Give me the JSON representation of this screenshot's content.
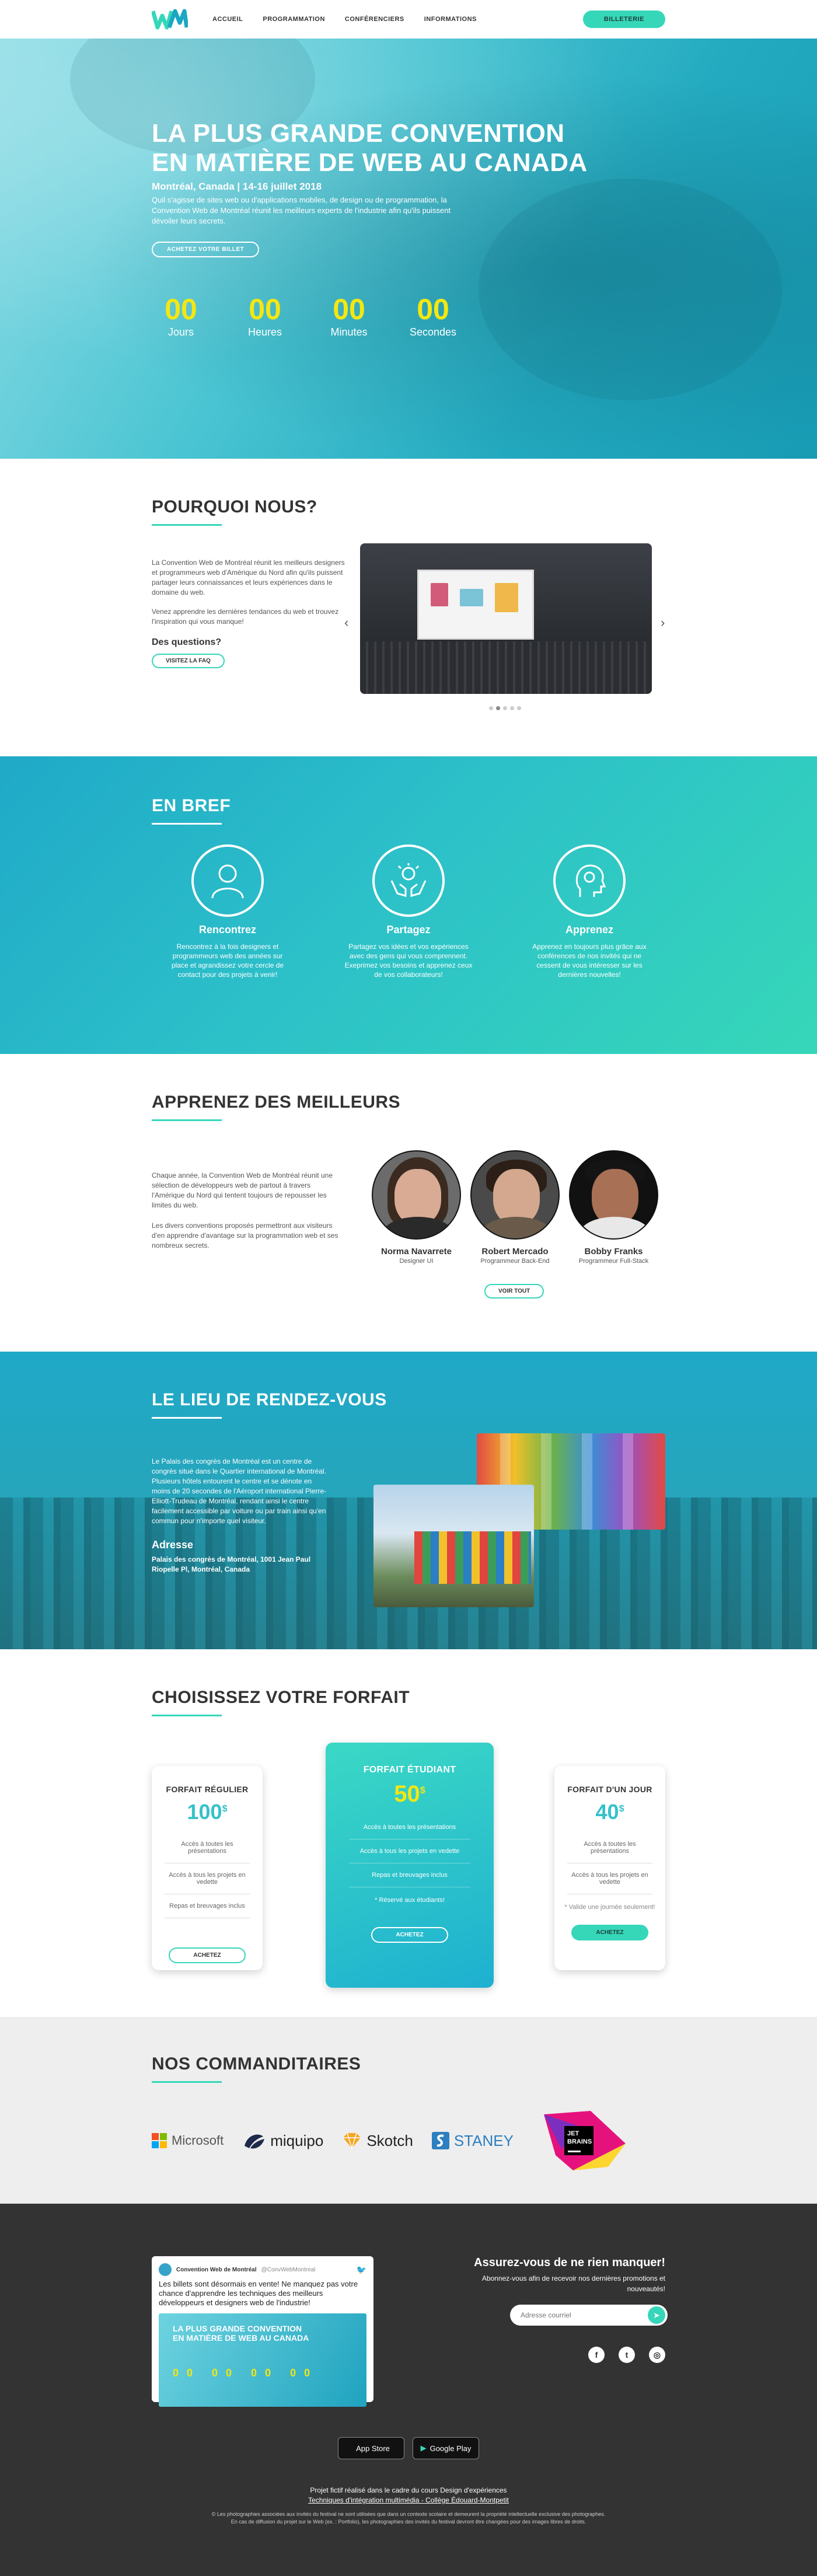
{
  "nav": {
    "links": [
      "ACCUEIL",
      "PROGRAMMATION",
      "CONFÉRENCIERS",
      "INFORMATIONS"
    ],
    "ticket_button": "BILLETERIE"
  },
  "hero": {
    "title_line1": "LA PLUS GRANDE CONVENTION",
    "title_line2": "EN MATIÈRE DE WEB AU CANADA",
    "subtitle": "Montréal, Canada | 14-16 juillet 2018",
    "description": "Quil s'agisse de sites web ou d'applications mobiles, de design ou de programmation, la Convention Web de Montréal réunit les meilleurs experts de l'industrie afin qu'ils puissent dévoiler leurs secrets.",
    "cta": "ACHETEZ VOTRE BILLET",
    "countdown": [
      {
        "value": "00",
        "label": "Jours"
      },
      {
        "value": "00",
        "label": "Heures"
      },
      {
        "value": "00",
        "label": "Minutes"
      },
      {
        "value": "00",
        "label": "Secondes"
      }
    ]
  },
  "why": {
    "title": "POURQUOI NOUS?",
    "p1": "La Convention Web de Montréal réunit les meilleurs designers et programmeurs web d'Amérique du Nord afin qu'ils puissent partager leurs connaissances et leurs expériences dans le domaine du web.",
    "p2": "Venez apprendre les dernières tendances du web et trouvez l'inspiration qui vous manque!",
    "questions": "Des questions?",
    "faq_button": "VISITEZ LA FAQ"
  },
  "brief": {
    "title": "EN BREF",
    "items": [
      {
        "title": "Rencontrez",
        "text": "Rencontrez à la fois designers et programmeurs web des années sur place et agrandissez votre cercle de contact pour des projets à venir!"
      },
      {
        "title": "Partagez",
        "text": "Partagez vos idées et vos expériences avec des gens qui vous comprennent. Exeprimez vos besoins et apprenez ceux de vos collaborateurs!"
      },
      {
        "title": "Apprenez",
        "text": "Apprenez en toujours plus grâce aux conférences de nos invités qui ne cessent de vous intéresser sur les dernières nouvelles!"
      }
    ]
  },
  "best": {
    "title": "APPRENEZ DES MEILLEURS",
    "p1": "Chaque année, la Convention Web de Montréal réunit une sélection de développeurs web de partout à travers l'Amérique du Nord qui tentent toujours de repousser les limites du web.",
    "p2": "Les divers conventions proposés permettront aux visiteurs d'en apprendre d'avantage sur la programmation web et ses nombreux secrets.",
    "speakers": [
      {
        "name": "Norma Navarrete",
        "role": "Designer UI"
      },
      {
        "name": "Robert Mercado",
        "role": "Programmeur Back-End"
      },
      {
        "name": "Bobby Franks",
        "role": "Programmeur Full-Stack"
      }
    ],
    "see_all": "VOIR TOUT"
  },
  "place": {
    "title": "LE LIEU DE RENDEZ-VOUS",
    "text": "Le Palais des congrès de Montréal est un centre de congrès situé dans le Quartier international de Montréal. Plusieurs hôtels entourent le centre et se dénote en moins de 20 secondes de l'Aéroport international Pierre-Elliott-Trudeau de Montréal, rendant ainsi le centre facilement accessible par voiture ou par train ainsi qu'en commun pour n'importe quel visiteur.",
    "address_title": "Adresse",
    "address": "Palais des congrès de Montréal, 1001 Jean Paul Riopelle Pl, Montréal, Canada"
  },
  "pricing": {
    "title": "CHOISISSEZ VOTRE FORFAIT",
    "plans": [
      {
        "name": "FORFAIT RÉGULIER",
        "price": "100",
        "currency": "$",
        "features": [
          "Accès à toutes les présentations",
          "Accès à tous les projets en vedette",
          "Repas et breuvages inclus"
        ],
        "note": "",
        "button": "ACHETEZ"
      },
      {
        "name": "FORFAIT ÉTUDIANT",
        "price": "50",
        "currency": "$",
        "features": [
          "Accès à toutes les présentations",
          "Accès à tous les projets en vedette",
          "Repas et breuvages inclus"
        ],
        "note": "* Réservé aux étudiants!",
        "button": "ACHETEZ"
      },
      {
        "name": "FORFAIT D'UN JOUR",
        "price": "40",
        "currency": "$",
        "features": [
          "Accès à toutes les présentations",
          "Accès à tous les projets en vedette"
        ],
        "note": "* Valide une journée seulement!",
        "button": "ACHETEZ"
      }
    ]
  },
  "sponsors": {
    "title": "NOS COMMANDITAIRES",
    "logos": [
      "Microsoft",
      "miquipo",
      "Skotch",
      "STANEY",
      "JET BRAINS"
    ]
  },
  "footer": {
    "tweet_account": "Convention Web de Montréal",
    "tweet_handle": "@ConvWebMontreal",
    "tweet_text": "Les billets sont désormais en vente! Ne manquez pas votre chance d'apprendre les techniques des meilleurs développeurs et designers web de l'industrie!",
    "tweet_image_line1": "LA PLUS GRANDE CONVENTION",
    "tweet_image_line2": "EN MATIÈRE DE WEB AU CANADA",
    "tweet_image_countdown": "00 00 00 00",
    "newsletter_title": "Assurez-vous de ne rien manquer!",
    "newsletter_text": "Abonnez-vous afin de recevoir nos dernières promotions et nouveautés!",
    "email_placeholder": "Adresse courriel",
    "app_store": "App Store",
    "google_play": "Google Play",
    "credit1": "Projet fictif réalisé dans le cadre du cours Design d'expériences",
    "credit2": "Techniques d'intégration multimédia - Collège Édouard-Montpetit",
    "credit3": "© Les photographies associées aux invités du festival ne sont utilisées que dans un contexte scolaire et demeurent la propriété intellectuelle exclusive des photographes.",
    "credit4": "En cas de diffusion du projet sur le Web (ex. : Portfolio), les photographies des invités du festival devront être changées pour des images libres de droits."
  }
}
